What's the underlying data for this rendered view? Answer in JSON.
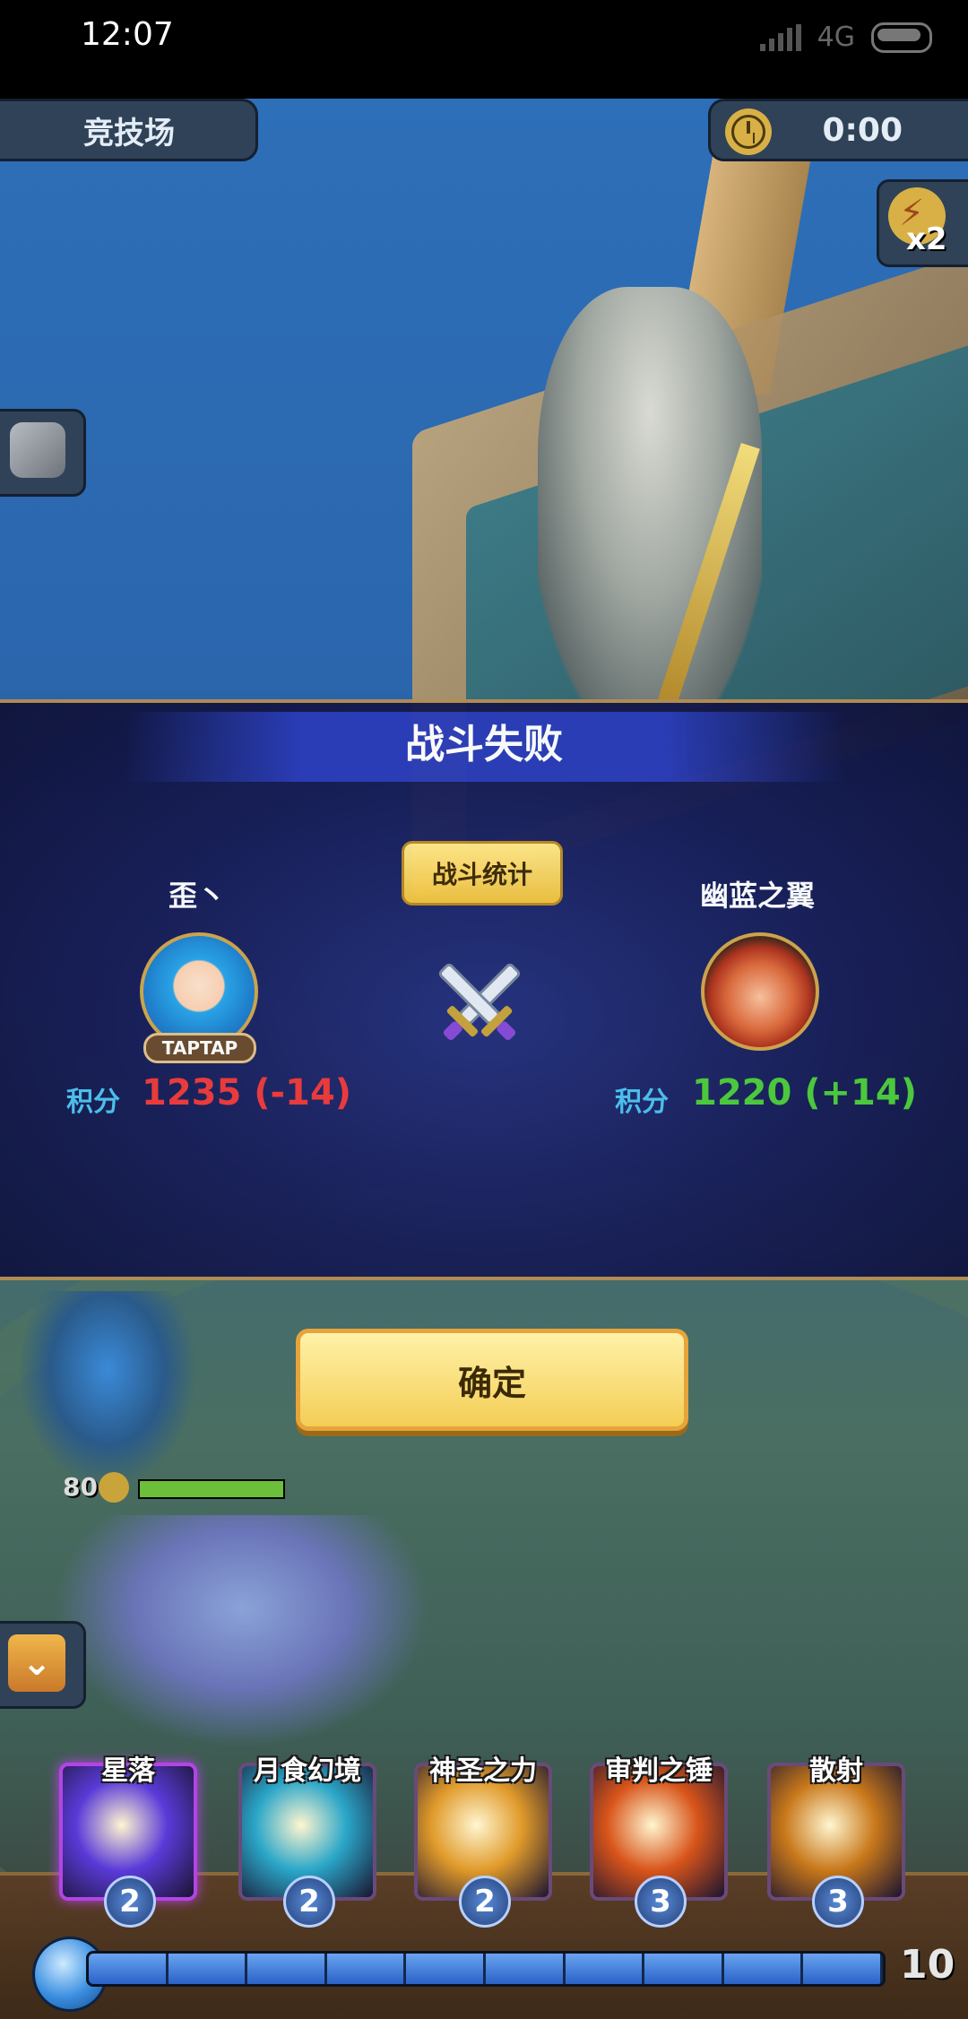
{
  "status_bar": {
    "time": "12:07",
    "network": "4G"
  },
  "hud": {
    "mode_title": "竞技场",
    "timer": "0:00",
    "speed_multiplier": "x2"
  },
  "result": {
    "title": "战斗失败",
    "stats_button": "战斗统计",
    "player_left": {
      "name": "歪丶",
      "badge": "TAPTAP",
      "score_label": "积分",
      "score": "1235 (-14)"
    },
    "player_right": {
      "name": "幽蓝之翼",
      "score_label": "积分",
      "score": "1220 (+14)"
    },
    "confirm_button": "确定"
  },
  "unit": {
    "level": "80",
    "hp_fraction": 1.0
  },
  "skills": [
    {
      "name": "星落",
      "cost": "2",
      "color": "#5a3ad8",
      "selected": true
    },
    {
      "name": "月食幻境",
      "cost": "2",
      "color": "#2aa6c8",
      "selected": false
    },
    {
      "name": "神圣之力",
      "cost": "2",
      "color": "#e09a2a",
      "selected": false
    },
    {
      "name": "审判之锤",
      "cost": "3",
      "color": "#d8541a",
      "selected": false
    },
    {
      "name": "散射",
      "cost": "3",
      "color": "#c8781a",
      "selected": false
    }
  ],
  "mana": {
    "segments": 10,
    "current": 10,
    "max": "10"
  },
  "colors": {
    "panel_border": "#b58d52",
    "loss": "#f03a3a",
    "gain": "#4ccc3a",
    "score_label": "#4cc2f0",
    "button_gold": "#f4ce56"
  }
}
